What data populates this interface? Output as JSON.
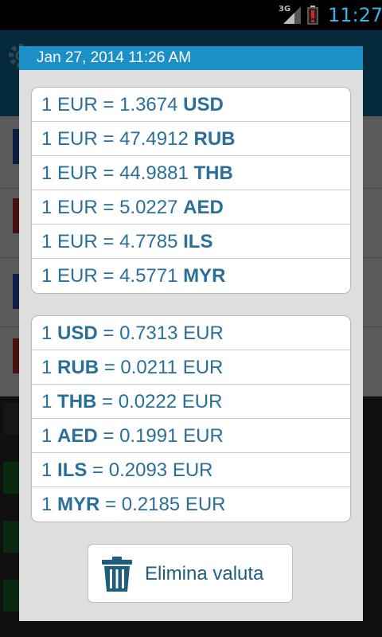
{
  "status_bar": {
    "network": "3G",
    "time": "11:27",
    "accent_color": "#33b5e5"
  },
  "dialog": {
    "title": "Jan 27, 2014 11:26 AM",
    "eur_to_foreign": [
      {
        "base_amount": "1",
        "base": "EUR",
        "rate": "1.3674",
        "code": "USD"
      },
      {
        "base_amount": "1",
        "base": "EUR",
        "rate": "47.4912",
        "code": "RUB"
      },
      {
        "base_amount": "1",
        "base": "EUR",
        "rate": "44.9881",
        "code": "THB"
      },
      {
        "base_amount": "1",
        "base": "EUR",
        "rate": "5.0227",
        "code": "AED"
      },
      {
        "base_amount": "1",
        "base": "EUR",
        "rate": "4.7785",
        "code": "ILS"
      },
      {
        "base_amount": "1",
        "base": "EUR",
        "rate": "4.5771",
        "code": "MYR"
      }
    ],
    "foreign_to_eur": [
      {
        "amount": "1",
        "code": "USD",
        "rate": "0.7313",
        "base": "EUR"
      },
      {
        "amount": "1",
        "code": "RUB",
        "rate": "0.0211",
        "base": "EUR"
      },
      {
        "amount": "1",
        "code": "THB",
        "rate": "0.0222",
        "base": "EUR"
      },
      {
        "amount": "1",
        "code": "AED",
        "rate": "0.1991",
        "base": "EUR"
      },
      {
        "amount": "1",
        "code": "ILS",
        "rate": "0.2093",
        "base": "EUR"
      },
      {
        "amount": "1",
        "code": "MYR",
        "rate": "0.2185",
        "base": "EUR"
      }
    ],
    "delete_button": {
      "label": "Elimina valuta",
      "icon": "trash-icon"
    },
    "colors": {
      "title_bar": "#1d8fc7",
      "rate_text": "#2a6f9a"
    }
  }
}
